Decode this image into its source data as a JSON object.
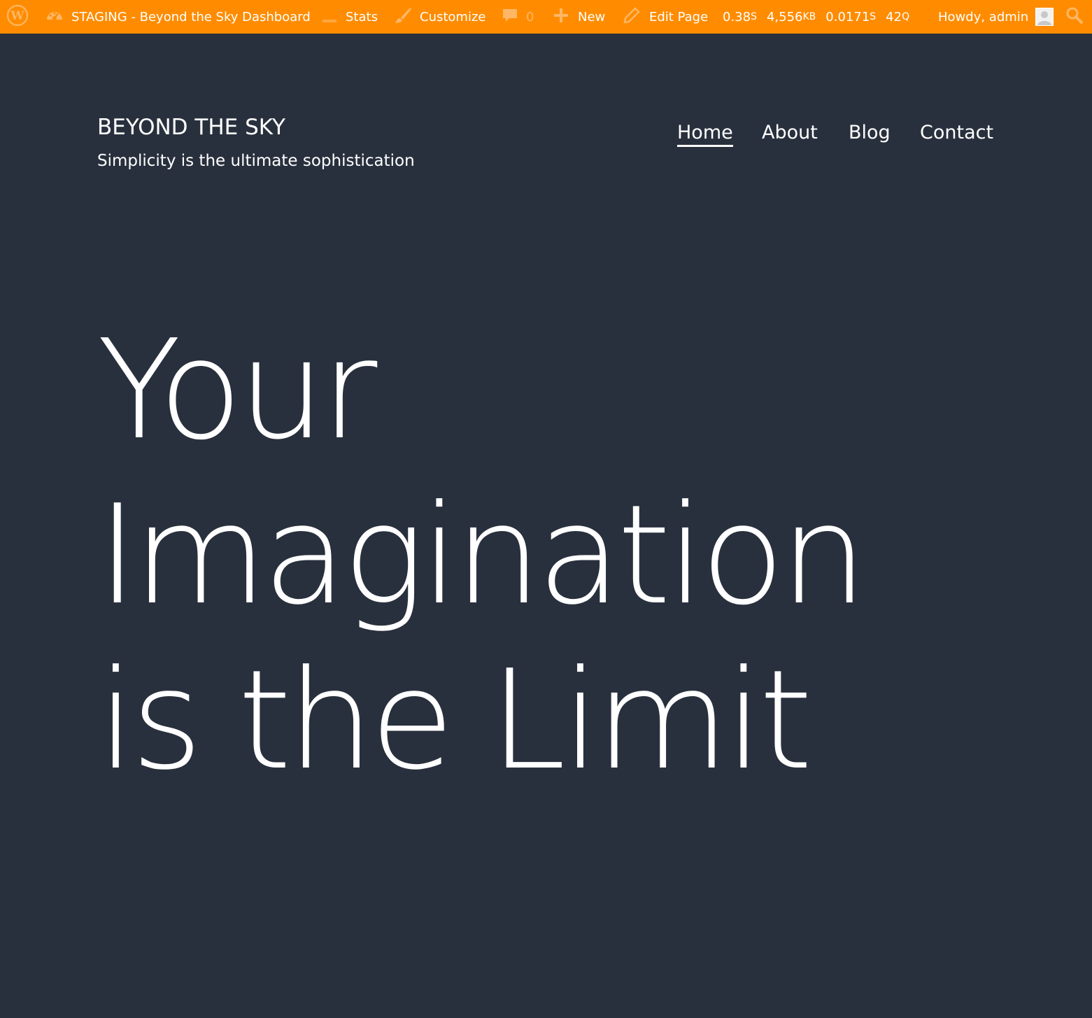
{
  "adminbar": {
    "bg_color": "#ff8c00",
    "site_label": "STAGING - Beyond the Sky Dashboard",
    "stats_label": "Stats",
    "customize_label": "Customize",
    "comments_count": "0",
    "new_label": "New",
    "edit_label": "Edit Page",
    "qm_time": "0.38",
    "qm_time_unit": "S",
    "qm_memory": "4,556",
    "qm_memory_unit": "KB",
    "qm_db_time": "0.0171",
    "qm_db_time_unit": "S",
    "qm_queries": "42",
    "qm_queries_unit": "Q",
    "greeting": "Howdy, admin",
    "icons": [
      "wordpress-logo-icon",
      "dashboard-icon",
      "stats-icon",
      "paintbrush-icon",
      "comment-icon",
      "plus-icon",
      "pencil-icon",
      "avatar-icon",
      "search-icon"
    ]
  },
  "header": {
    "site_title": "BEYOND THE SKY",
    "tagline": "Simplicity is the ultimate sophistication"
  },
  "nav": {
    "items": [
      {
        "label": "Home",
        "current": true
      },
      {
        "label": "About",
        "current": false
      },
      {
        "label": "Blog",
        "current": false
      },
      {
        "label": "Contact",
        "current": false
      }
    ]
  },
  "hero": {
    "lines": [
      "Your",
      "Imagination",
      "is the Limit"
    ]
  },
  "colors": {
    "page_bg": "#29303d",
    "text": "#ffffff"
  }
}
